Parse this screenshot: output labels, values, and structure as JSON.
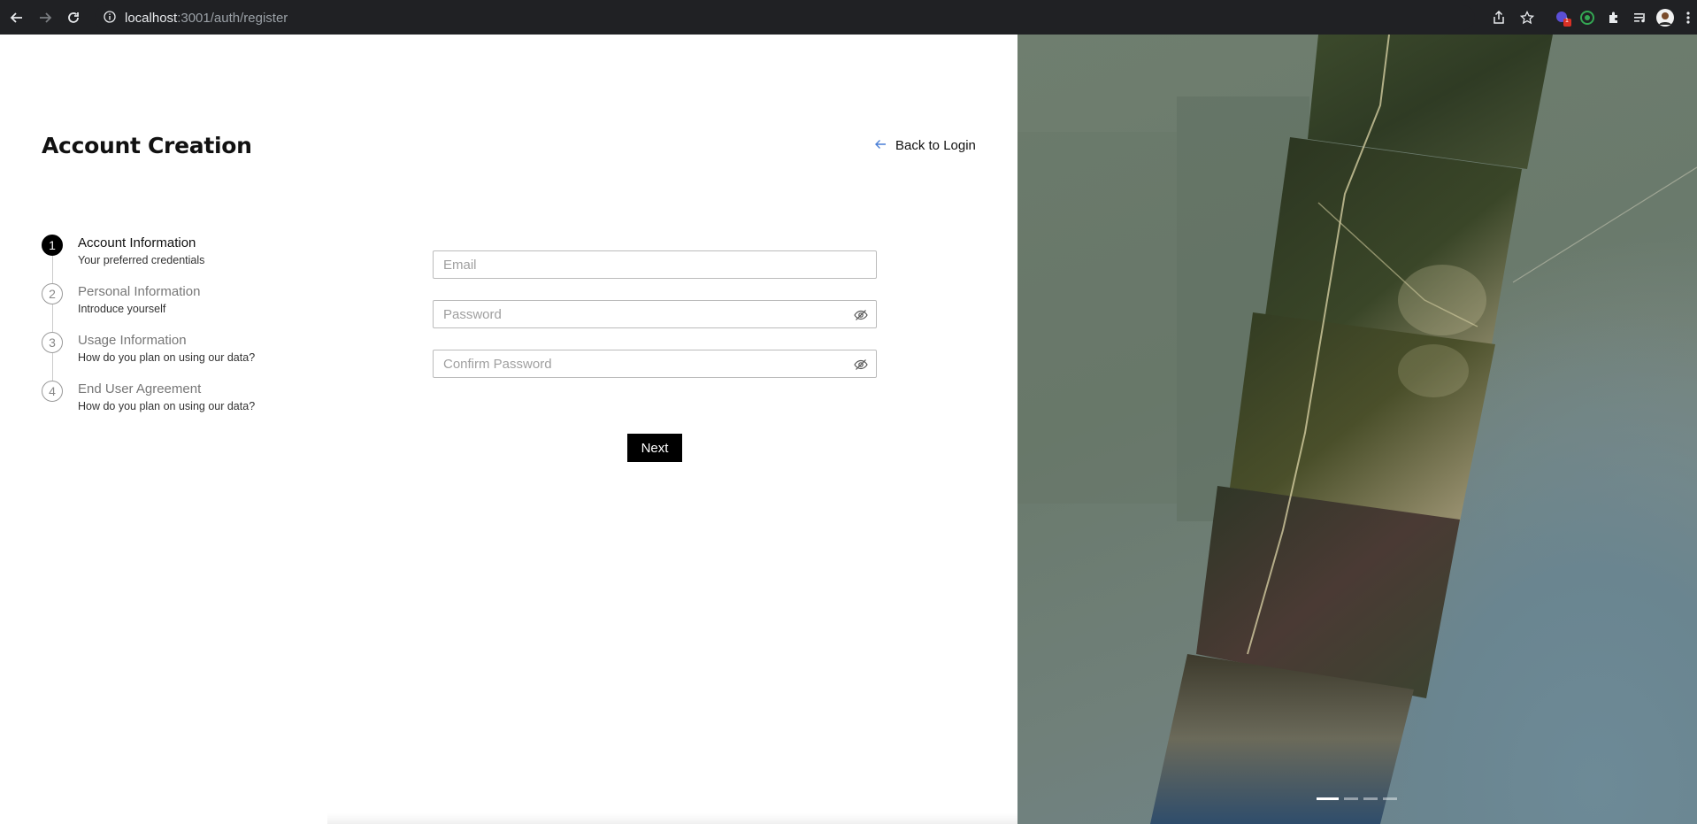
{
  "browser": {
    "url_host": "localhost",
    "url_path": ":3001/auth/register",
    "extension_badge": "1"
  },
  "page": {
    "title": "Account Creation",
    "back_label": "Back to Login"
  },
  "steps": [
    {
      "num": "1",
      "title": "Account Information",
      "sub": "Your preferred credentials",
      "active": true
    },
    {
      "num": "2",
      "title": "Personal Information",
      "sub": "Introduce yourself",
      "active": false
    },
    {
      "num": "3",
      "title": "Usage Information",
      "sub": "How do you plan on using our data?",
      "active": false
    },
    {
      "num": "4",
      "title": "End User Agreement",
      "sub": "How do you plan on using our data?",
      "active": false
    }
  ],
  "form": {
    "email_placeholder": "Email",
    "password_placeholder": "Password",
    "confirm_placeholder": "Confirm Password",
    "next_label": "Next"
  },
  "carousel": {
    "slide_count": 4,
    "active_index": 0
  },
  "colors": {
    "accent_icon": "#4a7fd6",
    "primary": "#000000"
  }
}
